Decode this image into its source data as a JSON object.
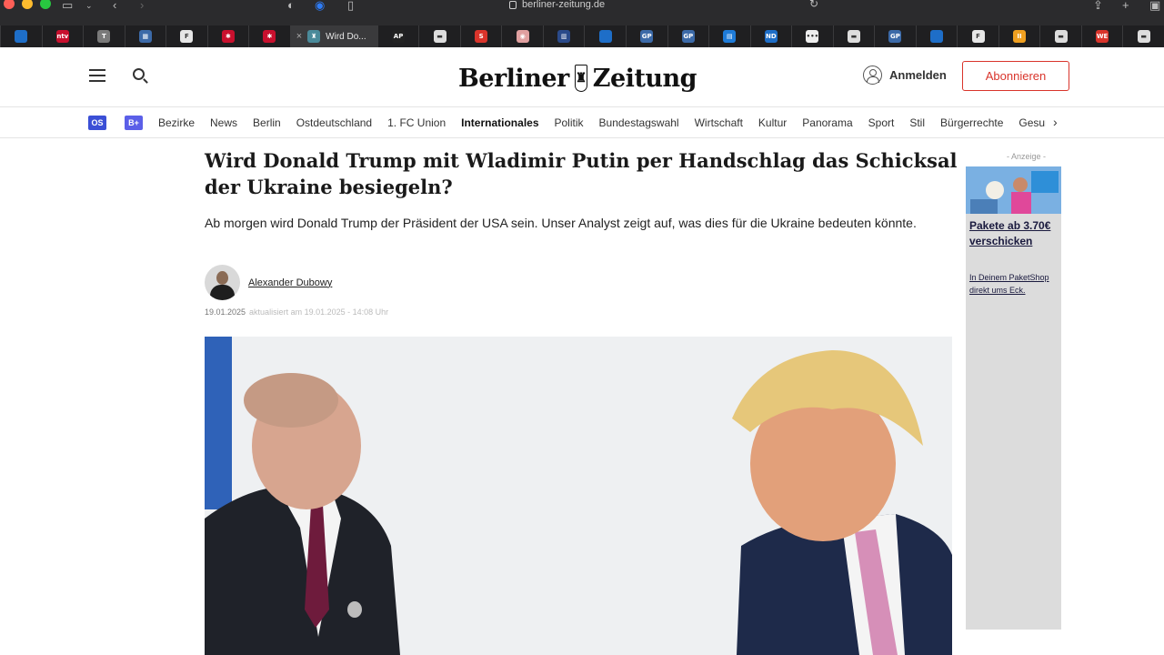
{
  "browser": {
    "url": "berliner-zeitung.de",
    "active_tab_title": "Wird Do...",
    "tabs": [
      {
        "icon": "news-app-icon",
        "color": "#1e6ec8",
        "text": ""
      },
      {
        "icon": "ntv-icon",
        "color": "#c8102e",
        "text": "ntv"
      },
      {
        "icon": "t-site-icon",
        "color": "#7a7a7a",
        "text": "T"
      },
      {
        "icon": "grid-site-icon",
        "color": "#3c6aa8",
        "text": "▦"
      },
      {
        "icon": "f-site-icon",
        "color": "#e6e6e6",
        "text": "F"
      },
      {
        "icon": "berlin-bear-icon",
        "color": "#c8102e",
        "text": "✱"
      },
      {
        "icon": "berlin-bear-icon",
        "color": "#c8102e",
        "text": "✱"
      },
      {
        "icon": "ap-icon",
        "color": "#222222",
        "text": "AP"
      },
      {
        "icon": "doc-site-icon",
        "color": "#dddddd",
        "text": "▬"
      },
      {
        "icon": "s-site-icon",
        "color": "#d9342b",
        "text": "S"
      },
      {
        "icon": "round-site-icon",
        "color": "#e0a0a0",
        "text": "◉"
      },
      {
        "icon": "bank-site-icon",
        "color": "#2a4a8a",
        "text": "▥"
      },
      {
        "icon": "news-app-icon",
        "color": "#1e6ec8",
        "text": ""
      },
      {
        "icon": "gp-icon",
        "color": "#3c6aa8",
        "text": "GP"
      },
      {
        "icon": "gp-icon",
        "color": "#3c6aa8",
        "text": "GP"
      },
      {
        "icon": "blue-square-icon",
        "color": "#1e7bd8",
        "text": "▤"
      },
      {
        "icon": "ndr-icon",
        "color": "#1e6ec8",
        "text": "ND"
      },
      {
        "icon": "dots-site-icon",
        "color": "#eeeeee",
        "text": "•••"
      },
      {
        "icon": "doc-site-icon",
        "color": "#dddddd",
        "text": "▬"
      },
      {
        "icon": "gp-icon",
        "color": "#3c6aa8",
        "text": "GP"
      },
      {
        "icon": "news-app-icon",
        "color": "#1e6ec8",
        "text": ""
      },
      {
        "icon": "f-site-icon",
        "color": "#e6e6e6",
        "text": "F"
      },
      {
        "icon": "orange-circle-icon",
        "color": "#f0a020",
        "text": "II"
      },
      {
        "icon": "doc-site-icon",
        "color": "#dddddd",
        "text": "▬"
      },
      {
        "icon": "we-site-icon",
        "color": "#d9342b",
        "text": "WE"
      },
      {
        "icon": "doc-site-icon",
        "color": "#dddddd",
        "text": "▬"
      }
    ]
  },
  "header": {
    "logo_text_left": "Berliner",
    "logo_text_right": "Zeitung",
    "login_label": "Anmelden",
    "subscribe_label": "Abonnieren",
    "accent_color": "#d9342b"
  },
  "nav": {
    "badge_os": "OS",
    "badge_plus": "B+",
    "items": [
      "Bezirke",
      "News",
      "Berlin",
      "Ostdeutschland",
      "1. FC Union",
      "Internationales",
      "Politik",
      "Bundestagswahl",
      "Wirtschaft",
      "Kultur",
      "Panorama",
      "Sport",
      "Stil",
      "Bürgerrechte",
      "Gesundheit"
    ],
    "active_index": 5
  },
  "article": {
    "headline": "Wird Donald Trump mit Wladimir Putin per Handschlag das Schicksal der Ukraine besiegeln?",
    "lead": "Ab morgen wird Donald Trump der Präsident der USA sein. Unser Analyst zeigt auf, was dies für die Ukraine bedeuten könnte.",
    "author": "Alexander Dubowy",
    "published": "19.01.2025",
    "updated": "aktualisiert am 19.01.2025 - 14:08 Uhr"
  },
  "ad": {
    "label": "- Anzeige -",
    "title": "Pakete ab 3.70€ verschicken",
    "text": "In Deinem PaketShop direkt ums Eck."
  }
}
